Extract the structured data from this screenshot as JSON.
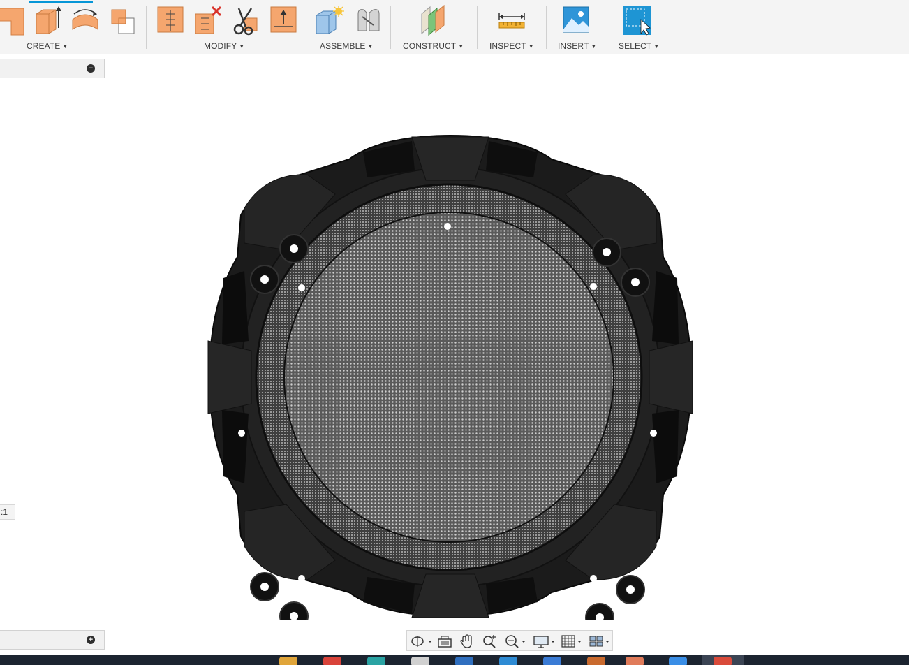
{
  "toolbar": {
    "groups": [
      {
        "id": "create",
        "label": "CREATE"
      },
      {
        "id": "modify",
        "label": "MODIFY"
      },
      {
        "id": "assemble",
        "label": "ASSEMBLE"
      },
      {
        "id": "construct",
        "label": "CONSTRUCT"
      },
      {
        "id": "inspect",
        "label": "INSPECT"
      },
      {
        "id": "insert",
        "label": "INSERT"
      },
      {
        "id": "select",
        "label": "SELECT"
      }
    ],
    "caret": "▼"
  },
  "browser": {
    "collapse_glyph": "−",
    "expand_glyph": "+"
  },
  "viewport": {
    "scale_badge": ":1"
  },
  "icons": {
    "create": [
      "sketch-icon",
      "extrude-icon",
      "revolve-icon",
      "combine-icon"
    ],
    "modify": [
      "press-pull-icon",
      "delete-icon",
      "split-body-icon",
      "offset-face-icon"
    ],
    "assemble": [
      "new-component-icon",
      "joint-icon"
    ],
    "construct": [
      "offset-plane-icon"
    ],
    "inspect": [
      "measure-icon"
    ],
    "insert": [
      "insert-image-icon"
    ],
    "select": [
      "select-window-icon"
    ],
    "navbar": [
      "orbit-icon",
      "look-at-icon",
      "pan-icon",
      "zoom-icon",
      "fit-icon",
      "display-settings-icon",
      "grid-icon",
      "viewports-icon"
    ]
  },
  "colors": {
    "accent": "#0696d7",
    "create_orange": "#f5a66e",
    "model_body": "#1b1b1b",
    "mesh": "#6f6f6f"
  }
}
